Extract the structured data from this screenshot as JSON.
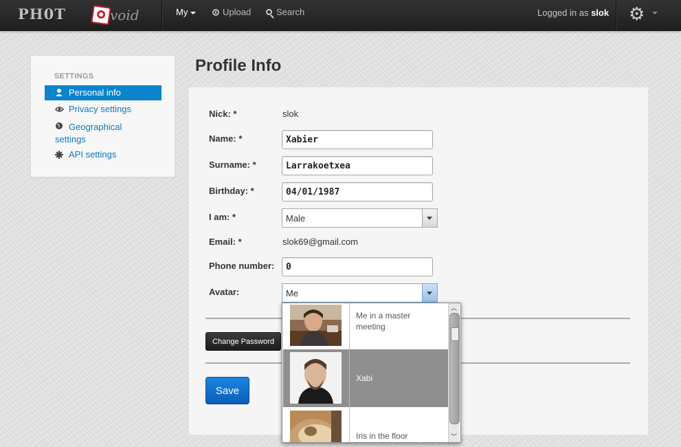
{
  "brand": {
    "text": "PH0T",
    "suffix": "void"
  },
  "topnav": {
    "my_label": "My",
    "upload_label": "Upload",
    "search_label": "Search",
    "logged_prefix": "Logged in as",
    "username": "slok"
  },
  "sidebar": {
    "header": "SETTINGS",
    "items": [
      {
        "label": "Personal info",
        "icon": "user-icon",
        "active": true
      },
      {
        "label": "Privacy settings",
        "icon": "eye-icon"
      },
      {
        "label": "Geographical settings",
        "icon": "globe-icon"
      },
      {
        "label": "API settings",
        "icon": "cog-icon"
      }
    ]
  },
  "main": {
    "title": "Profile Info",
    "fields": {
      "nick": {
        "label": "Nick: *",
        "value": "slok"
      },
      "name": {
        "label": "Name: *",
        "value": "Xabier"
      },
      "surname": {
        "label": "Surname: *",
        "value": "Larrakoetxea"
      },
      "birthday": {
        "label": "Birthday: *",
        "value": "04/01/1987"
      },
      "iam": {
        "label": "I am: *",
        "value": "Male"
      },
      "email": {
        "label": "Email: *",
        "value": "slok69@gmail.com"
      },
      "phone": {
        "label": "Phone number:",
        "value": "0"
      },
      "avatar": {
        "label": "Avatar:",
        "value": "Me"
      }
    },
    "change_password_label": "Change Password",
    "save_label": "Save",
    "avatar_options": [
      {
        "caption": "Me in a master meeting"
      },
      {
        "caption": "Xabi",
        "selected": true
      },
      {
        "caption": "Iris in the floor"
      }
    ]
  }
}
